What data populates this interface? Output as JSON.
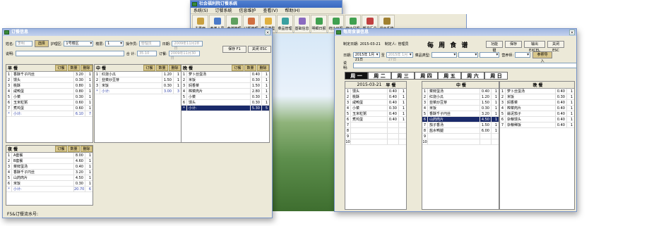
{
  "main_window": {
    "title": "社会福利院订餐系统",
    "menu": [
      "系统(S)",
      "订餐系统",
      "信息维护",
      "查看(V)",
      "帮助(H)"
    ],
    "toolbar": [
      "主界面",
      "养老人员",
      "食谱管理",
      "订餐管理",
      "菜品类型",
      "菜品管理",
      "基础信息",
      "明细日报",
      "统计日报",
      "统计月报",
      "概况汇总",
      "退出系统"
    ]
  },
  "order_window": {
    "title": "订餐信息",
    "form": {
      "name_label": "姓名:",
      "name_value": "李明",
      "select_btn": "选择",
      "area_label": "护理区:",
      "area_value": "1号楼区",
      "floor_label": "楼层:",
      "floor_value": "1",
      "operator_label": "操作员:",
      "operator_value": "管理员",
      "date_label": "日期:",
      "date_value": "2009年11月28日",
      "save_btn": "保存 F1",
      "close_btn": "关闭 ESC",
      "note_label": "说明:",
      "total_label": "合 计:",
      "total_value": "35.10",
      "order_label": "订餐:",
      "order_value": "2009年11月30日"
    },
    "col_headers": [
      "订餐",
      "数量",
      "删除"
    ],
    "panels": [
      {
        "title": "早 餐",
        "rows": [
          [
            "1",
            "香酥千子円丝",
            "3.20",
            "1"
          ],
          [
            "2",
            "馒头",
            "0.30",
            "1"
          ],
          [
            "3",
            "桃酥",
            "0.80",
            "1"
          ],
          [
            "4",
            "咸鸭蛋",
            "0.80",
            "1"
          ],
          [
            "5",
            "小菜",
            "0.30",
            "1"
          ],
          [
            "6",
            "玉米粒粥",
            "0.60",
            "1"
          ],
          [
            "7",
            "煮鸡蛋",
            "0.60",
            "1"
          ]
        ],
        "subtotal": [
          "6.10",
          "7"
        ]
      },
      {
        "title": "中 餐",
        "rows": [
          [
            "1",
            "红烧小瓜",
            "1.20",
            "1"
          ],
          [
            "2",
            "韭菜炒豆芽",
            "1.50",
            "1"
          ],
          [
            "3",
            "米饭",
            "0.30",
            "1"
          ]
        ],
        "subtotal": [
          "3.00",
          "3"
        ]
      },
      {
        "title": "晚 餐",
        "rows": [
          [
            "1",
            "萝卜丝蛋汤",
            "0.40",
            "1"
          ],
          [
            "2",
            "米饭",
            "0.30",
            "1"
          ],
          [
            "3",
            "焖香菜",
            "1.50",
            "1"
          ],
          [
            "4",
            "榨菜肉片",
            "2.80",
            "1"
          ],
          [
            "5",
            "小菜",
            "0.30",
            "1"
          ],
          [
            "6",
            "馒头",
            "0.30",
            "1"
          ]
        ],
        "subtotal": [
          "5.30",
          "5"
        ]
      },
      {
        "title": "夜 餐",
        "rows": [
          [
            "1",
            "A套餐",
            "8.00",
            "1"
          ],
          [
            "2",
            "B套餐",
            "4.60",
            "1"
          ],
          [
            "3",
            "菜鲜蛋汤",
            "0.40",
            "1"
          ],
          [
            "4",
            "香酥千子円丝",
            "3.20",
            "1"
          ],
          [
            "5",
            "山药肉片",
            "4.50",
            "1"
          ],
          [
            "6",
            "米饭",
            "0.30",
            "1"
          ]
        ],
        "subtotal": [
          "20.70",
          "6"
        ]
      }
    ],
    "status": "F5&订餐流水号:"
  },
  "recipe_window": {
    "title": "每周食谱信息",
    "form": {
      "create_time_label": "制定日期:",
      "create_time_value": "2015-03-21",
      "creator_label": "制定人:",
      "creator_value": "管理员",
      "heading": "每 周 食 谱",
      "btn1": "功能键",
      "btn2": "保存",
      "btn3": "输出 EXCEL",
      "btn4": "关闭 ESC",
      "date_label": "日期:",
      "date_from": "2015年 1月21日",
      "date_to": "2015年 1月27日",
      "dish_label": "菜品类型:",
      "nutrition_label": "营养师:",
      "import_btn": "参照导入",
      "note_label": "说明:"
    },
    "weekdays": [
      "周 一",
      "周 二",
      "周 三",
      "周 四",
      "周 五",
      "周 六",
      "周 日"
    ],
    "active_day": 0,
    "date_head": "2015-03-21",
    "meals": [
      "早 餐",
      "中 餐",
      "晚 餐"
    ],
    "breakfast": [
      [
        "1",
        "馒头",
        "0.40",
        "1"
      ],
      [
        "2",
        "桃酥",
        "0.40",
        "1"
      ],
      [
        "3",
        "咸鸭蛋",
        "0.40",
        "1"
      ],
      [
        "4",
        "小菜",
        "0.30",
        "1"
      ],
      [
        "5",
        "玉米粒粥",
        "0.40",
        "1"
      ],
      [
        "6",
        "煮鸡蛋",
        "0.40",
        "1"
      ],
      [
        "7",
        "",
        ""
      ],
      [
        "8",
        "",
        ""
      ],
      [
        "9",
        "",
        ""
      ],
      [
        "10",
        "",
        ""
      ]
    ],
    "lunch": [
      [
        "1",
        "菜鲜蛋汤",
        "0.40",
        "1"
      ],
      [
        "2",
        "红烧小瓜",
        "1.20",
        "1"
      ],
      [
        "3",
        "韭菜炒豆芽",
        "1.50",
        "1"
      ],
      [
        "4",
        "米饭",
        "0.30",
        "1"
      ],
      [
        "5",
        "香酥千子円丝",
        "3.20",
        "1"
      ],
      [
        "6",
        "山药肉片",
        "4.50",
        "1"
      ],
      [
        "7",
        "茄子香汤",
        "1.50",
        "1"
      ],
      [
        "8",
        "盐水鸭腿",
        "6.00",
        "1"
      ],
      [
        "9",
        "",
        ""
      ],
      [
        "10",
        "",
        ""
      ]
    ],
    "dinner": [
      [
        "1",
        "萝卜丝蛋汤",
        "0.40",
        "1"
      ],
      [
        "2",
        "米饭",
        "0.30",
        "1"
      ],
      [
        "3",
        "焖香菜",
        "0.40",
        "1"
      ],
      [
        "4",
        "榨菜肉片",
        "0.40",
        "1"
      ],
      [
        "5",
        "蒜泥茄子",
        "0.40",
        "1"
      ],
      [
        "6",
        "杂粮馒头",
        "0.40",
        "1"
      ],
      [
        "7",
        "杂粮稀饭",
        "0.40",
        "1"
      ]
    ]
  }
}
